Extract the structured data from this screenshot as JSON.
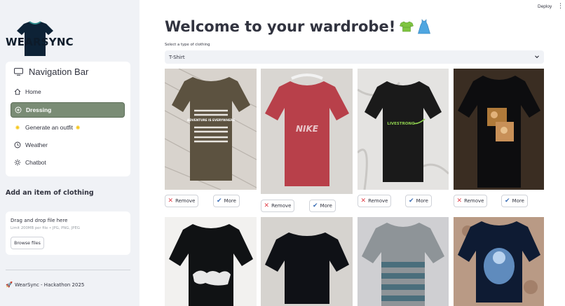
{
  "header": {
    "deploy_label": "Deploy",
    "menu_icon": "kebab-menu-icon"
  },
  "sidebar": {
    "logo_text": "WEARSYNC",
    "nav_title": "Navigation Bar",
    "items": [
      {
        "label": "Home",
        "icon": "home-icon"
      },
      {
        "label": "Dressing",
        "icon": "plus-circle-icon"
      },
      {
        "label": "Generate an outfit",
        "icon": "sparkle-icon"
      },
      {
        "label": "Weather",
        "icon": "clock-icon"
      },
      {
        "label": "Chatbot",
        "icon": "sun-icon"
      }
    ],
    "active_item": "Dressing",
    "add_title": "Add an item of clothing",
    "uploader": {
      "title": "Drag and drop file here",
      "limit": "Limit 200MB per file • JPG, PNG, JPEG",
      "browse_label": "Browse files"
    },
    "footer": "WearSync - Hackathon 2025"
  },
  "main": {
    "title": "Welcome to your wardrobe!",
    "select_label": "Select a type of clothing",
    "selected_type": "T-Shirt",
    "remove_label": "Remove",
    "more_label": "More",
    "shirt_prints": [
      "ADVENTURE IS EVERYWHERE",
      "NIKE",
      "LIVESTRONG"
    ],
    "colors": {
      "accent": "#7a8c75",
      "remove_icon": "#e0404a",
      "more_icon": "#3d6fb6",
      "sidebar_bg": "#f0f2f6"
    }
  }
}
